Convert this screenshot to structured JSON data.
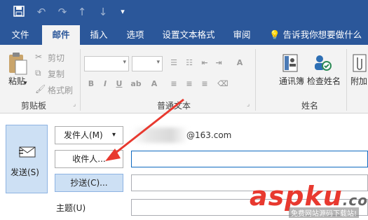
{
  "quick_access": {
    "icons": [
      "save-icon",
      "undo-icon",
      "redo-icon",
      "up-icon",
      "down-icon",
      "customize-icon"
    ]
  },
  "tabs": [
    {
      "label": "文件",
      "active": false
    },
    {
      "label": "邮件",
      "active": true
    },
    {
      "label": "插入",
      "active": false
    },
    {
      "label": "选项",
      "active": false
    },
    {
      "label": "设置文本格式",
      "active": false
    },
    {
      "label": "审阅",
      "active": false
    }
  ],
  "tell_me": "告诉我你想要做什么",
  "ribbon": {
    "clipboard": {
      "paste": "粘贴",
      "cut": "剪切",
      "copy": "复制",
      "format_painter": "格式刷",
      "group": "剪贴板"
    },
    "basic_text": {
      "group": "普通文本"
    },
    "names": {
      "address_book": "通讯簿",
      "check_names": "检查姓名",
      "group": "姓名"
    },
    "attach": "附加"
  },
  "compose": {
    "send": "发送(S)",
    "from_label": "发件人(M)",
    "from_value": "@163.com",
    "to_button": "收件人...",
    "cc_button": "抄送(C)...",
    "subject_label": "主题(U)"
  },
  "watermark": {
    "brand": "aspku",
    "com": ".com",
    "tagline": "免费网站源码下载站!"
  },
  "colors": {
    "accent": "#2b579a",
    "arrow": "#e8392f",
    "send_bg": "#cde0f4"
  }
}
